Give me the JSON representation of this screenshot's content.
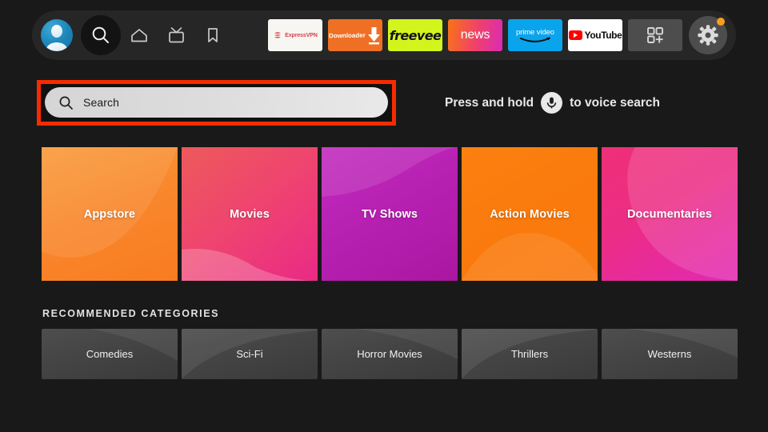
{
  "topbar": {
    "profile": {
      "name": "profile-avatar",
      "label": "Profile"
    },
    "nav": [
      {
        "icon": "search-icon",
        "label": "Search"
      },
      {
        "icon": "home-icon",
        "label": "Home"
      },
      {
        "icon": "live-tv-icon",
        "label": "Live TV"
      },
      {
        "icon": "bookmark-icon",
        "label": "Watchlist"
      }
    ],
    "apps": [
      {
        "id": "expressvpn",
        "label": "ExpressVPN"
      },
      {
        "id": "downloader",
        "label": "Downloader"
      },
      {
        "id": "freevee",
        "label": "freevee"
      },
      {
        "id": "news",
        "label": "news"
      },
      {
        "id": "prime-video",
        "label": "prime video"
      },
      {
        "id": "youtube",
        "label": "YouTube"
      },
      {
        "id": "apps-grid",
        "label": "Apps"
      }
    ],
    "settings": {
      "label": "Settings",
      "has_notification": true,
      "badge_color": "#f99d1c"
    }
  },
  "search": {
    "placeholder": "Search",
    "value": "",
    "highlight_color": "#f62b00",
    "voice_prefix": "Press and hold",
    "voice_suffix": "to voice search",
    "mic_icon": "microphone-icon"
  },
  "categories": {
    "tiles": [
      {
        "label": "Appstore",
        "color": "#f9862c"
      },
      {
        "label": "Movies",
        "color": "#ef4370"
      },
      {
        "label": "TV Shows",
        "color": "#b51fb0"
      },
      {
        "label": "Action Movies",
        "color": "#fa7a0d"
      },
      {
        "label": "Documentaries",
        "color": "#ec2d86"
      }
    ]
  },
  "recommended": {
    "heading": "RECOMMENDED CATEGORIES",
    "tiles": [
      {
        "label": "Comedies"
      },
      {
        "label": "Sci-Fi"
      },
      {
        "label": "Horror Movies"
      },
      {
        "label": "Thrillers"
      },
      {
        "label": "Westerns"
      }
    ]
  }
}
